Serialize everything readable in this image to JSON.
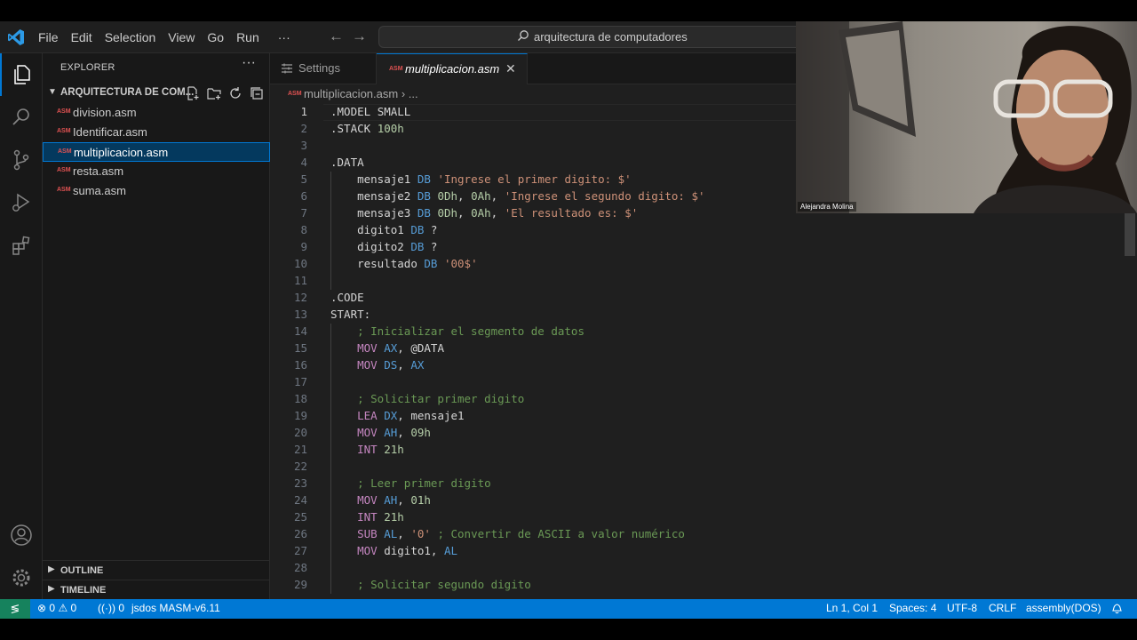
{
  "menu": [
    "File",
    "Edit",
    "Selection",
    "View",
    "Go",
    "Run",
    "···"
  ],
  "command_center": "arquitectura de computadores",
  "explorer": {
    "title": "EXPLORER",
    "more": "···",
    "folder": "ARQUITECTURA DE COM...",
    "file_icon_text": "ASM",
    "files": [
      "division.asm",
      "Identificar.asm",
      "multiplicacion.asm",
      "resta.asm",
      "suma.asm"
    ],
    "selected_index": 2,
    "sections": [
      "OUTLINE",
      "TIMELINE"
    ]
  },
  "tabs": [
    {
      "label": "Settings",
      "active": false
    },
    {
      "label": "multiplicacion.asm",
      "active": true,
      "close": "✕"
    }
  ],
  "breadcrumb": "multiplicacion.asm  ›  ...",
  "editor": {
    "current_line": 1,
    "lines": [
      {
        "n": "1",
        "text": ".MODEL SMALL"
      },
      {
        "n": "2",
        "text": ".STACK 100h"
      },
      {
        "n": "3",
        "text": ""
      },
      {
        "n": "4",
        "text": ".DATA"
      },
      {
        "n": "5",
        "text": "    mensaje1 DB 'Ingrese el primer digito: $'"
      },
      {
        "n": "6",
        "text": "    mensaje2 DB 0Dh, 0Ah, 'Ingrese el segundo digito: $'"
      },
      {
        "n": "7",
        "text": "    mensaje3 DB 0Dh, 0Ah, 'El resultado es: $'"
      },
      {
        "n": "8",
        "text": "    digito1 DB ?"
      },
      {
        "n": "9",
        "text": "    digito2 DB ?"
      },
      {
        "n": "10",
        "text": "    resultado DB '00$'"
      },
      {
        "n": "11",
        "text": ""
      },
      {
        "n": "12",
        "text": ".CODE"
      },
      {
        "n": "13",
        "text": "START:"
      },
      {
        "n": "14",
        "text": "    ; Inicializar el segmento de datos"
      },
      {
        "n": "15",
        "text": "    MOV AX, @DATA"
      },
      {
        "n": "16",
        "text": "    MOV DS, AX"
      },
      {
        "n": "17",
        "text": ""
      },
      {
        "n": "18",
        "text": "    ; Solicitar primer digito"
      },
      {
        "n": "19",
        "text": "    LEA DX, mensaje1"
      },
      {
        "n": "20",
        "text": "    MOV AH, 09h"
      },
      {
        "n": "21",
        "text": "    INT 21h"
      },
      {
        "n": "22",
        "text": ""
      },
      {
        "n": "23",
        "text": "    ; Leer primer digito"
      },
      {
        "n": "24",
        "text": "    MOV AH, 01h"
      },
      {
        "n": "25",
        "text": "    INT 21h"
      },
      {
        "n": "26",
        "text": "    SUB AL, '0' ; Convertir de ASCII a valor numérico"
      },
      {
        "n": "27",
        "text": "    MOV digito1, AL"
      },
      {
        "n": "28",
        "text": ""
      },
      {
        "n": "29",
        "text": "    ; Solicitar segundo digito"
      }
    ]
  },
  "webcam": {
    "name": "Alejandra Molina"
  },
  "statusbar": {
    "errors": "0",
    "warnings": "0",
    "ports": "0",
    "extension": "jsdos MASM-v6.11",
    "position": "Ln 1, Col 1",
    "spaces": "Spaces: 4",
    "encoding": "UTF-8",
    "eol": "CRLF",
    "language": "assembly(DOS)"
  },
  "colors": {
    "accent": "#0078d4",
    "remote": "#16825d",
    "keyword": "#569cd6",
    "string": "#ce9178",
    "comment": "#6a9955",
    "instruction": "#c586c0",
    "number": "#b5cea8"
  }
}
